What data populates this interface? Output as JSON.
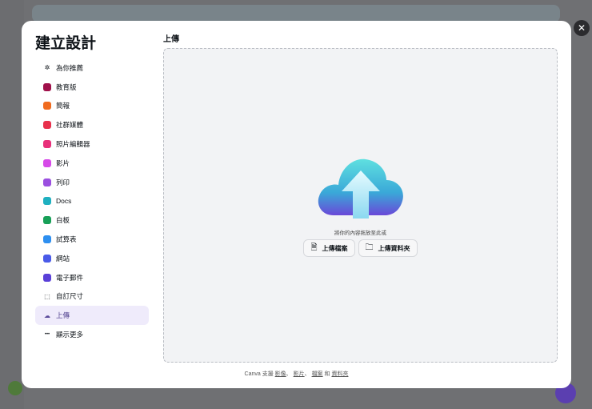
{
  "modal": {
    "title": "建立設計",
    "close_icon": "close-icon"
  },
  "sidebar": {
    "items": [
      {
        "label": "為你推薦",
        "icon": "sparkle-icon",
        "color": "#0e1318"
      },
      {
        "label": "教育版",
        "icon": "graduation-cap-icon",
        "color": "#a0114a"
      },
      {
        "label": "簡報",
        "icon": "presentation-icon",
        "color": "#f06b1f"
      },
      {
        "label": "社群媒體",
        "icon": "heart-icon",
        "color": "#e8304c"
      },
      {
        "label": "照片編輯器",
        "icon": "camera-icon",
        "color": "#e8307a"
      },
      {
        "label": "影片",
        "icon": "video-icon",
        "color": "#d64ae8"
      },
      {
        "label": "列印",
        "icon": "printer-icon",
        "color": "#9b4fe0"
      },
      {
        "label": "Docs",
        "icon": "doc-icon",
        "color": "#1fb0c0"
      },
      {
        "label": "白板",
        "icon": "whiteboard-icon",
        "color": "#18a058"
      },
      {
        "label": "試算表",
        "icon": "spreadsheet-icon",
        "color": "#2e8ff0"
      },
      {
        "label": "網站",
        "icon": "website-icon",
        "color": "#4a5ae8"
      },
      {
        "label": "電子郵件",
        "icon": "mail-icon",
        "color": "#5a40d8"
      },
      {
        "label": "自訂尺寸",
        "icon": "custom-size-icon",
        "color": "#0e1318"
      },
      {
        "label": "上傳",
        "icon": "cloud-upload-icon",
        "color": "#5a4a9a"
      },
      {
        "label": "顯示更多",
        "icon": "more-icon",
        "color": "#0e1318"
      }
    ],
    "active": "上傳"
  },
  "main": {
    "section_title": "上傳",
    "hint": "將你的內容拖放至此或",
    "upload_file": "上傳檔案",
    "upload_folder": "上傳資料夾",
    "footer": {
      "prefix": "Canva 支援",
      "images": "影像",
      "sep1": "、",
      "videos": "影片",
      "sep2": "、",
      "files": "檔案",
      "and": "和",
      "folders": "資料夾"
    }
  }
}
